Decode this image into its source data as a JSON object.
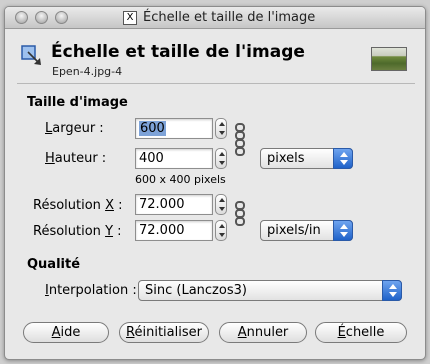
{
  "window": {
    "title": "Échelle et taille de l'image",
    "title_icon": "x-icon"
  },
  "header": {
    "title": "Échelle et taille de l'image",
    "subtitle": "Epen-4.jpg-4",
    "icon": "scale-image-icon"
  },
  "image_size": {
    "section_label": "Taille d'image",
    "width": {
      "label_prefix": "",
      "label_key": "L",
      "label_rest": "argeur :",
      "value_selected": "600"
    },
    "height": {
      "label_key": "H",
      "label_rest": "auteur :",
      "value": "400"
    },
    "size_info": "600 x 400 pixels",
    "unit": "pixels",
    "res_x": {
      "label_prefix": "Résolution ",
      "label_key": "X",
      "label_rest": " :",
      "value": "72.000"
    },
    "res_y": {
      "label_prefix": "Résolution ",
      "label_key": "Y",
      "label_rest": " :",
      "value": "72.000"
    },
    "res_unit": "pixels/in"
  },
  "quality": {
    "section_label": "Qualité",
    "interp_key": "I",
    "interp_rest": "nterpolation :",
    "interpolation": "Sinc (Lanczos3)"
  },
  "buttons": {
    "help": {
      "key": "A",
      "rest": "ide"
    },
    "reset": {
      "key": "R",
      "rest": "éinitialiser"
    },
    "cancel": {
      "key": "A",
      "rest": "nnuler"
    },
    "scale": {
      "key": "É",
      "rest": "chelle"
    }
  },
  "colors": {
    "accent": "#1f62c9",
    "selection": "#7ea3d8"
  }
}
